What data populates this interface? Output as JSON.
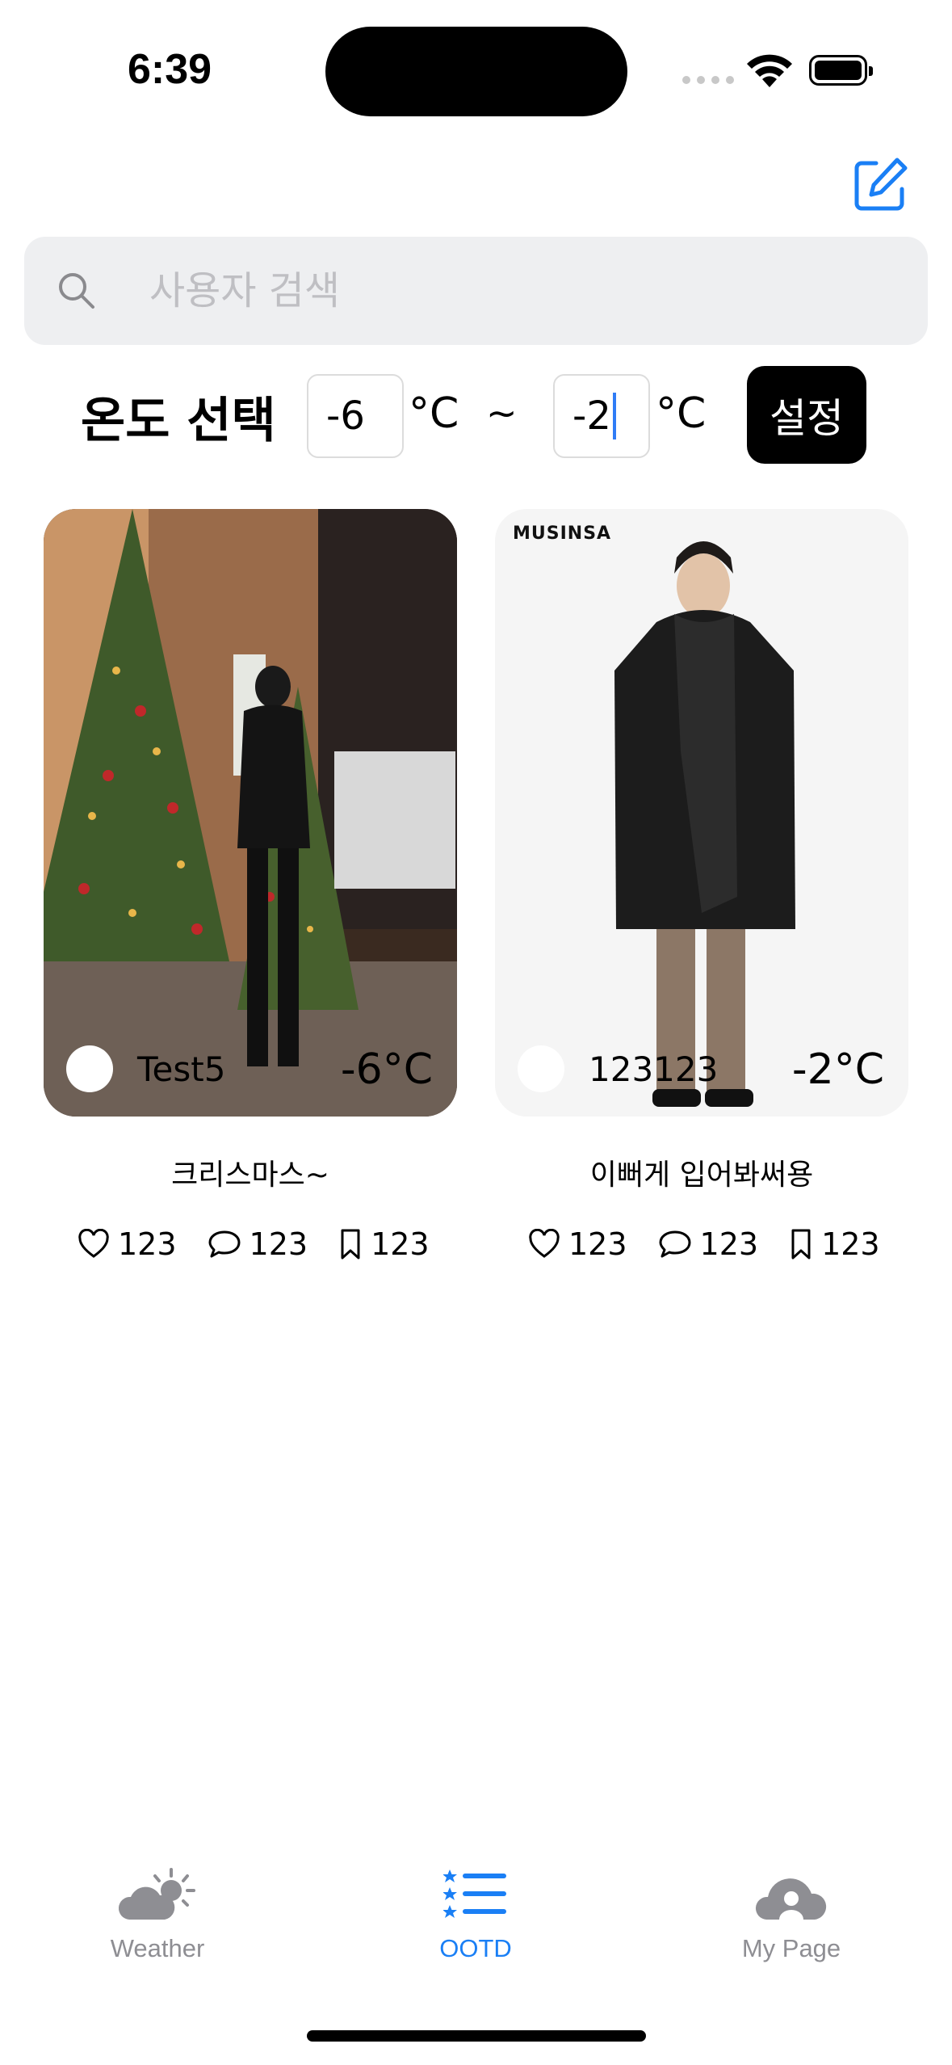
{
  "status_bar": {
    "time": "6:39"
  },
  "header": {
    "compose_icon": "square-and-pencil-icon",
    "accent_color": "#1a7ff5"
  },
  "search": {
    "placeholder": "사용자 검색",
    "value": ""
  },
  "temperature": {
    "label": "온도 선택",
    "min_value": "-6",
    "max_value": "-2",
    "unit": "°C",
    "separator": "~",
    "set_button": "설정"
  },
  "posts": [
    {
      "username": "Test5",
      "temperature": "-6°C",
      "caption": "크리스마스~",
      "likes": "123",
      "comments": "123",
      "bookmarks": "123"
    },
    {
      "brand": "MUSINSA",
      "username": "123123",
      "temperature": "-2°C",
      "caption": "이뻐게 입어봐써용",
      "likes": "123",
      "comments": "123",
      "bookmarks": "123"
    }
  ],
  "tabbar": {
    "items": [
      {
        "label": "Weather",
        "icon": "cloud-sun-icon",
        "active": false
      },
      {
        "label": "OOTD",
        "icon": "list-star-icon",
        "active": true
      },
      {
        "label": "My Page",
        "icon": "person-cloud-icon",
        "active": false
      }
    ]
  }
}
